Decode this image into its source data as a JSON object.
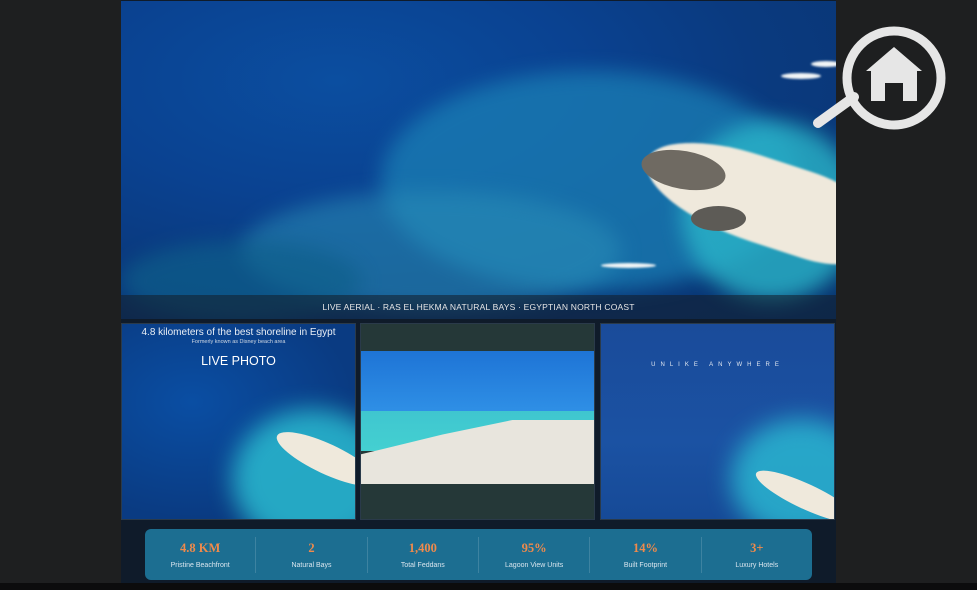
{
  "hero": {
    "caption": "LIVE AERIAL · RAS EL HEKMA NATURAL BAYS · EGYPTIAN NORTH COAST"
  },
  "thumbs": {
    "first": {
      "line1": "4.8 kilometers of the best shoreline in Egypt",
      "line2": "Formerly known as Disney beach area",
      "line3": "LIVE PHOTO"
    },
    "third": {
      "label": "UNLIKE ANYWHERE"
    }
  },
  "stats": [
    {
      "value": "4.8 KM",
      "label": "Pristine Beachfront"
    },
    {
      "value": "2",
      "label": "Natural Bays"
    },
    {
      "value": "1,400",
      "label": "Total Feddans"
    },
    {
      "value": "95%",
      "label": "Lagoon View Units"
    },
    {
      "value": "14%",
      "label": "Built Footprint"
    },
    {
      "value": "3+",
      "label": "Luxury Hotels"
    }
  ],
  "logo": {
    "icon": "home-search-icon",
    "color": "#e6e6e6"
  }
}
